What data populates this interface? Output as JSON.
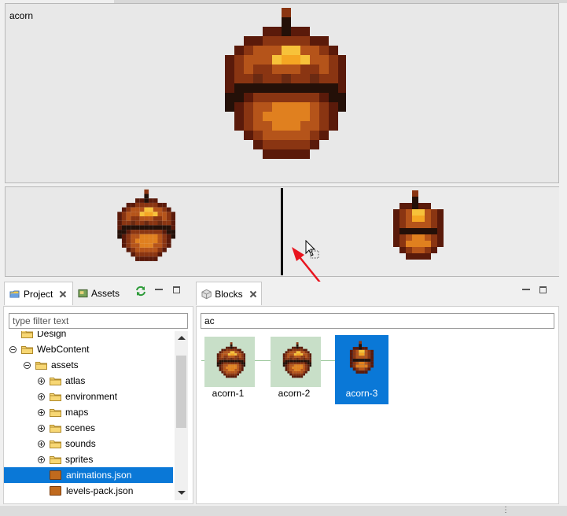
{
  "preview": {
    "title": "acorn"
  },
  "left_panel": {
    "tabs": [
      {
        "label": "Project",
        "icon": "project-icon",
        "active": true
      },
      {
        "label": "Assets",
        "icon": "assets-icon",
        "active": false
      }
    ],
    "filter_placeholder": "type filter text",
    "filter_value": "",
    "tree": [
      {
        "label": "Design",
        "type": "folder",
        "depth": 1,
        "toggle": "none"
      },
      {
        "label": "WebContent",
        "type": "folder",
        "depth": 1,
        "toggle": "minus"
      },
      {
        "label": "assets",
        "type": "folder",
        "depth": 2,
        "toggle": "minus"
      },
      {
        "label": "atlas",
        "type": "folder",
        "depth": 3,
        "toggle": "plus"
      },
      {
        "label": "environment",
        "type": "folder",
        "depth": 3,
        "toggle": "plus"
      },
      {
        "label": "maps",
        "type": "folder",
        "depth": 3,
        "toggle": "plus"
      },
      {
        "label": "scenes",
        "type": "folder",
        "depth": 3,
        "toggle": "plus"
      },
      {
        "label": "sounds",
        "type": "folder",
        "depth": 3,
        "toggle": "plus"
      },
      {
        "label": "sprites",
        "type": "folder",
        "depth": 3,
        "toggle": "plus"
      },
      {
        "label": "animations.json",
        "type": "json",
        "depth": 3,
        "toggle": "none",
        "selected": true
      },
      {
        "label": "levels-pack.json",
        "type": "json",
        "depth": 3,
        "toggle": "none"
      }
    ]
  },
  "right_panel": {
    "tab_label": "Blocks",
    "filter_value": "ac",
    "blocks": [
      {
        "label": "acorn-1",
        "selected": false
      },
      {
        "label": "acorn-2",
        "selected": false
      },
      {
        "label": "acorn-3",
        "selected": true
      }
    ]
  },
  "colors": {
    "selection": "#0a78d7",
    "block_bg": "#c8dfc8",
    "arrow": "#e8141e"
  }
}
